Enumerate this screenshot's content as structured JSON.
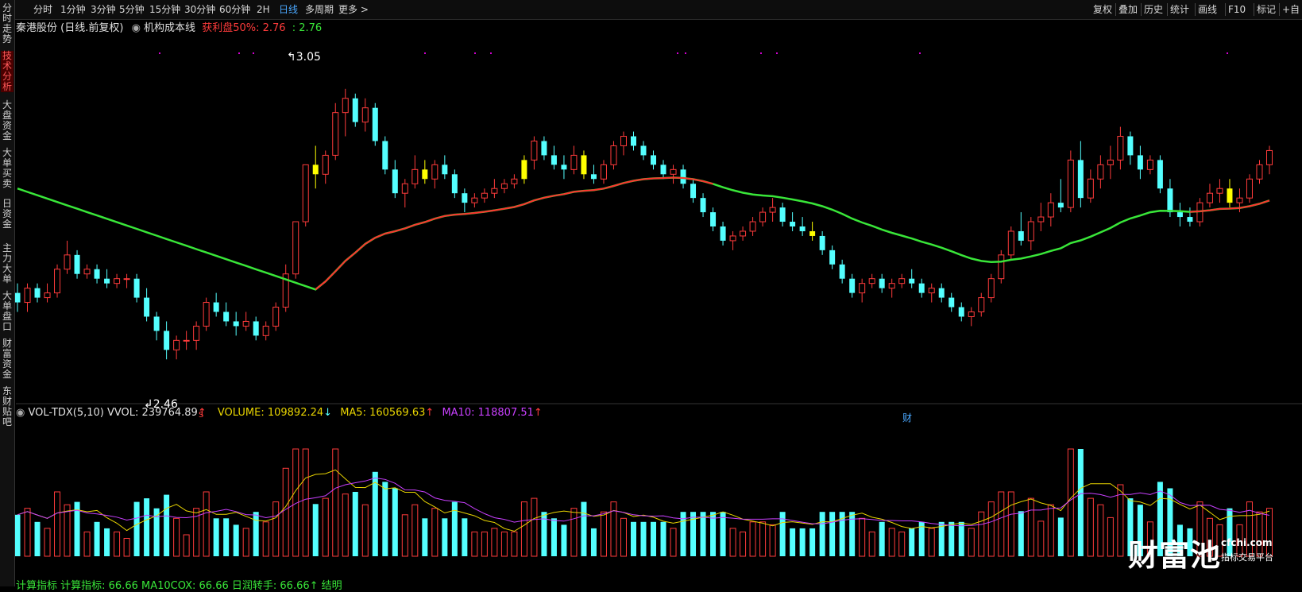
{
  "toolbar": {
    "periods": [
      "分时",
      "1分钟",
      "3分钟",
      "5分钟",
      "15分钟",
      "30分钟",
      "60分钟",
      "2H",
      "日线",
      "多周期",
      "更多"
    ],
    "active_period": "日线",
    "right_buttons": [
      "复权",
      "叠加",
      "历史",
      "统计",
      "画线",
      "F10",
      "标记",
      "+自"
    ]
  },
  "sidebar": {
    "items": [
      "分时走势",
      "技术分析",
      "大盘资金",
      "大单买卖",
      "日资金",
      "主力大单",
      "大单盘口",
      "财富资金",
      "东财贴吧"
    ],
    "active": "技术分析"
  },
  "info": {
    "stock": "秦港股份 (日线.前复权)",
    "indicator": "机构成本线",
    "profit_label": "获利盘50%: 2.76",
    "profit_value": ": 2.76"
  },
  "price_labels": {
    "high": "3.05",
    "low": "2.46",
    "marker_s": "S",
    "marker_cai": "财"
  },
  "volume": {
    "name": "VOL-TDX(5,10)",
    "vvol": "VVOL: 239764.89",
    "volume": "VOLUME: 109892.24",
    "ma5": "MA5: 160569.63",
    "ma10": "MA10: 118807.51"
  },
  "bottom": {
    "text": "计算指标  计算指标: 66.66  MA10COX: 66.66  日润转手: 66.66↑ 结明"
  },
  "watermark": {
    "name": "财富池",
    "url": "cfchi.com",
    "sub": "指标交易平台"
  },
  "colors": {
    "up": "#ff3b3b",
    "down": "#54ffff",
    "highlight": "#ffff00",
    "cost_up": "#ff3030",
    "cost_down": "#39e639",
    "ma5": "#e8d400",
    "ma10": "#c940ff"
  },
  "chart_data": {
    "type": "candlestick",
    "ylim": [
      2.4,
      3.12
    ],
    "candles": [
      [
        2.62,
        2.64,
        2.58,
        2.6
      ],
      [
        2.6,
        2.64,
        2.58,
        2.63
      ],
      [
        2.63,
        2.64,
        2.6,
        2.61
      ],
      [
        2.61,
        2.64,
        2.6,
        2.62
      ],
      [
        2.62,
        2.68,
        2.61,
        2.67
      ],
      [
        2.67,
        2.73,
        2.66,
        2.7
      ],
      [
        2.7,
        2.71,
        2.65,
        2.66
      ],
      [
        2.66,
        2.68,
        2.65,
        2.67
      ],
      [
        2.67,
        2.68,
        2.64,
        2.65
      ],
      [
        2.65,
        2.67,
        2.63,
        2.64
      ],
      [
        2.64,
        2.66,
        2.63,
        2.65
      ],
      [
        2.65,
        2.66,
        2.63,
        2.65
      ],
      [
        2.65,
        2.66,
        2.6,
        2.61
      ],
      [
        2.61,
        2.63,
        2.56,
        2.57
      ],
      [
        2.57,
        2.58,
        2.52,
        2.54
      ],
      [
        2.54,
        2.56,
        2.48,
        2.5
      ],
      [
        2.5,
        2.53,
        2.48,
        2.52
      ],
      [
        2.52,
        2.54,
        2.5,
        2.52
      ],
      [
        2.52,
        2.56,
        2.5,
        2.55
      ],
      [
        2.55,
        2.61,
        2.54,
        2.6
      ],
      [
        2.6,
        2.62,
        2.57,
        2.58
      ],
      [
        2.58,
        2.6,
        2.55,
        2.56
      ],
      [
        2.56,
        2.58,
        2.53,
        2.55
      ],
      [
        2.55,
        2.58,
        2.54,
        2.56
      ],
      [
        2.56,
        2.57,
        2.52,
        2.53
      ],
      [
        2.53,
        2.56,
        2.52,
        2.55
      ],
      [
        2.55,
        2.6,
        2.54,
        2.59
      ],
      [
        2.59,
        2.68,
        2.58,
        2.66
      ],
      [
        2.66,
        2.77,
        2.65,
        2.77
      ],
      [
        2.77,
        2.89,
        2.76,
        2.89
      ],
      [
        2.89,
        2.93,
        2.84,
        2.87
      ],
      [
        2.87,
        2.92,
        2.85,
        2.91
      ],
      [
        2.91,
        3.02,
        2.9,
        3.0
      ],
      [
        3.0,
        3.05,
        2.95,
        3.03
      ],
      [
        3.03,
        3.04,
        2.97,
        2.98
      ],
      [
        2.98,
        3.03,
        2.96,
        3.01
      ],
      [
        3.01,
        3.02,
        2.93,
        2.94
      ],
      [
        2.94,
        2.95,
        2.87,
        2.88
      ],
      [
        2.88,
        2.9,
        2.82,
        2.83
      ],
      [
        2.83,
        2.86,
        2.8,
        2.85
      ],
      [
        2.85,
        2.91,
        2.84,
        2.88
      ],
      [
        2.88,
        2.9,
        2.85,
        2.86
      ],
      [
        2.86,
        2.9,
        2.84,
        2.89
      ],
      [
        2.89,
        2.91,
        2.86,
        2.87
      ],
      [
        2.87,
        2.88,
        2.82,
        2.83
      ],
      [
        2.83,
        2.84,
        2.79,
        2.81
      ],
      [
        2.81,
        2.83,
        2.8,
        2.82
      ],
      [
        2.82,
        2.84,
        2.81,
        2.83
      ],
      [
        2.83,
        2.86,
        2.82,
        2.84
      ],
      [
        2.84,
        2.86,
        2.83,
        2.85
      ],
      [
        2.85,
        2.87,
        2.84,
        2.86
      ],
      [
        2.86,
        2.91,
        2.85,
        2.9
      ],
      [
        2.9,
        2.95,
        2.88,
        2.94
      ],
      [
        2.94,
        2.95,
        2.9,
        2.91
      ],
      [
        2.91,
        2.93,
        2.88,
        2.89
      ],
      [
        2.89,
        2.91,
        2.86,
        2.88
      ],
      [
        2.88,
        2.93,
        2.87,
        2.91
      ],
      [
        2.91,
        2.92,
        2.86,
        2.87
      ],
      [
        2.87,
        2.89,
        2.85,
        2.86
      ],
      [
        2.86,
        2.9,
        2.85,
        2.89
      ],
      [
        2.89,
        2.94,
        2.88,
        2.93
      ],
      [
        2.93,
        2.96,
        2.91,
        2.95
      ],
      [
        2.95,
        2.96,
        2.92,
        2.93
      ],
      [
        2.93,
        2.94,
        2.9,
        2.91
      ],
      [
        2.91,
        2.92,
        2.88,
        2.89
      ],
      [
        2.89,
        2.9,
        2.86,
        2.87
      ],
      [
        2.87,
        2.89,
        2.85,
        2.88
      ],
      [
        2.88,
        2.89,
        2.84,
        2.85
      ],
      [
        2.85,
        2.86,
        2.81,
        2.82
      ],
      [
        2.82,
        2.83,
        2.78,
        2.79
      ],
      [
        2.79,
        2.8,
        2.75,
        2.76
      ],
      [
        2.76,
        2.77,
        2.72,
        2.73
      ],
      [
        2.73,
        2.75,
        2.71,
        2.74
      ],
      [
        2.74,
        2.76,
        2.73,
        2.75
      ],
      [
        2.75,
        2.78,
        2.74,
        2.77
      ],
      [
        2.77,
        2.8,
        2.76,
        2.79
      ],
      [
        2.79,
        2.82,
        2.77,
        2.8
      ],
      [
        2.8,
        2.81,
        2.76,
        2.77
      ],
      [
        2.77,
        2.79,
        2.75,
        2.76
      ],
      [
        2.76,
        2.78,
        2.74,
        2.75
      ],
      [
        2.75,
        2.77,
        2.73,
        2.74
      ],
      [
        2.74,
        2.75,
        2.7,
        2.71
      ],
      [
        2.71,
        2.72,
        2.67,
        2.68
      ],
      [
        2.68,
        2.69,
        2.64,
        2.65
      ],
      [
        2.65,
        2.66,
        2.61,
        2.62
      ],
      [
        2.62,
        2.65,
        2.6,
        2.64
      ],
      [
        2.64,
        2.66,
        2.63,
        2.65
      ],
      [
        2.65,
        2.66,
        2.62,
        2.63
      ],
      [
        2.63,
        2.65,
        2.61,
        2.64
      ],
      [
        2.64,
        2.66,
        2.63,
        2.65
      ],
      [
        2.65,
        2.67,
        2.63,
        2.64
      ],
      [
        2.64,
        2.65,
        2.61,
        2.62
      ],
      [
        2.62,
        2.64,
        2.6,
        2.63
      ],
      [
        2.63,
        2.64,
        2.6,
        2.61
      ],
      [
        2.61,
        2.62,
        2.58,
        2.59
      ],
      [
        2.59,
        2.6,
        2.56,
        2.57
      ],
      [
        2.57,
        2.59,
        2.55,
        2.58
      ],
      [
        2.58,
        2.62,
        2.57,
        2.61
      ],
      [
        2.61,
        2.66,
        2.6,
        2.65
      ],
      [
        2.65,
        2.71,
        2.64,
        2.7
      ],
      [
        2.7,
        2.76,
        2.69,
        2.75
      ],
      [
        2.75,
        2.79,
        2.72,
        2.73
      ],
      [
        2.73,
        2.78,
        2.71,
        2.77
      ],
      [
        2.77,
        2.81,
        2.75,
        2.78
      ],
      [
        2.78,
        2.83,
        2.76,
        2.81
      ],
      [
        2.81,
        2.86,
        2.79,
        2.8
      ],
      [
        2.8,
        2.92,
        2.79,
        2.9
      ],
      [
        2.9,
        2.94,
        2.8,
        2.82
      ],
      [
        2.82,
        2.88,
        2.81,
        2.86
      ],
      [
        2.86,
        2.91,
        2.84,
        2.89
      ],
      [
        2.89,
        2.93,
        2.86,
        2.9
      ],
      [
        2.9,
        2.97,
        2.88,
        2.95
      ],
      [
        2.95,
        2.96,
        2.89,
        2.91
      ],
      [
        2.91,
        2.93,
        2.86,
        2.88
      ],
      [
        2.88,
        2.91,
        2.87,
        2.9
      ],
      [
        2.9,
        2.91,
        2.83,
        2.84
      ],
      [
        2.84,
        2.86,
        2.78,
        2.79
      ],
      [
        2.79,
        2.81,
        2.76,
        2.78
      ],
      [
        2.78,
        2.8,
        2.76,
        2.77
      ],
      [
        2.77,
        2.82,
        2.76,
        2.81
      ],
      [
        2.81,
        2.85,
        2.8,
        2.83
      ],
      [
        2.83,
        2.86,
        2.81,
        2.84
      ],
      [
        2.84,
        2.86,
        2.8,
        2.81
      ],
      [
        2.81,
        2.84,
        2.79,
        2.82
      ],
      [
        2.82,
        2.87,
        2.81,
        2.86
      ],
      [
        2.86,
        2.9,
        2.85,
        2.89
      ],
      [
        2.89,
        2.93,
        2.87,
        2.92
      ]
    ]
  }
}
